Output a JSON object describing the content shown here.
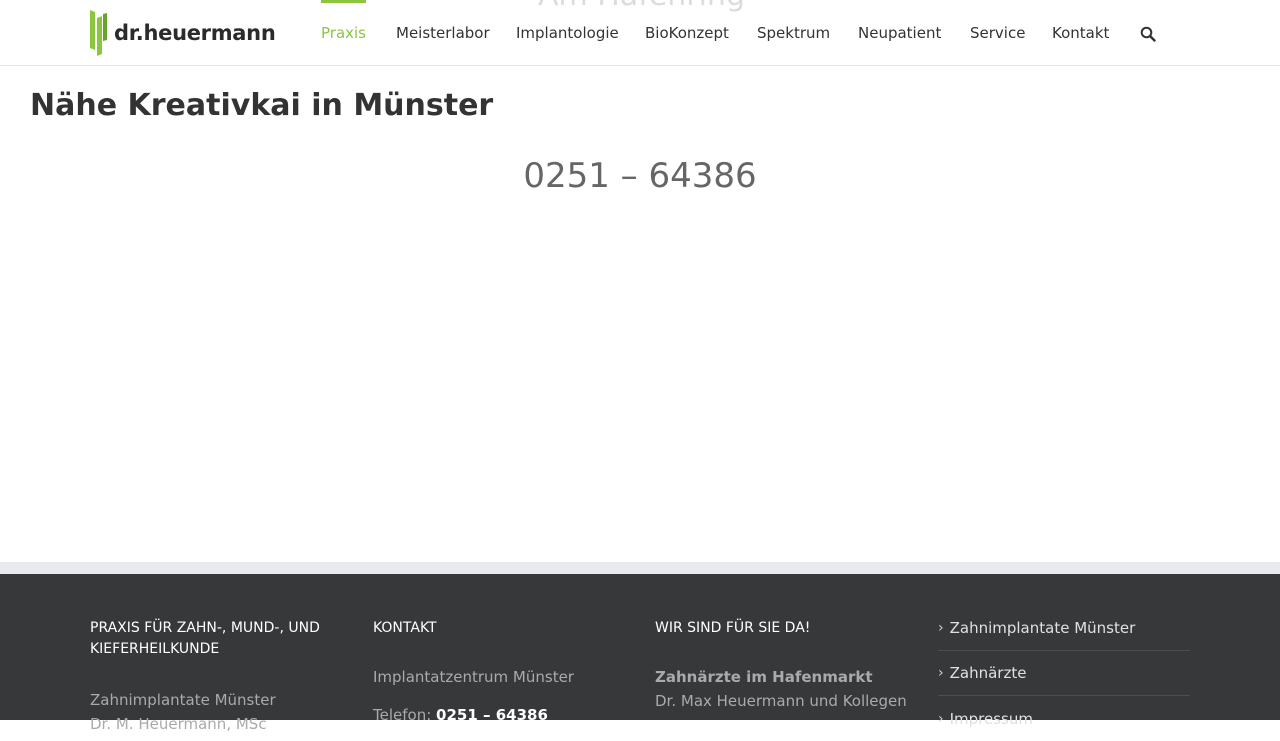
{
  "header": {
    "ghost_text": "Am Hafenring",
    "logo_text": "dr.heuermann",
    "logo_colors": {
      "green": "#8cc63f",
      "text": "#2b2b2b"
    },
    "nav": [
      {
        "label": "Praxis",
        "active": true
      },
      {
        "label": "Meisterlabor"
      },
      {
        "label": "Implantologie"
      },
      {
        "label": "BioKonzept"
      },
      {
        "label": "Spektrum"
      },
      {
        "label": "Neupatient"
      },
      {
        "label": "Service"
      },
      {
        "label": "Kontakt"
      }
    ],
    "search_icon": "search-icon"
  },
  "main": {
    "title": "Nähe Kreativkai in Münster",
    "phone": "0251 – 64386"
  },
  "footer": {
    "col1": {
      "heading": "PRAXIS FÜR ZAHN-, MUND-, UND KIEFERHEILKUNDE",
      "line1": "Zahnimplantate Münster",
      "line2": "Dr. M. Heuermann, MSc"
    },
    "col2": {
      "heading": "KONTAKT",
      "line1": "Implantatzentrum Münster",
      "phone_label": "Telefon:",
      "phone_value": "0251 – 64386"
    },
    "col3": {
      "heading": "WIR SIND FÜR SIE DA!",
      "line1": "Zahnärzte im Hafenmarkt",
      "line2": "Dr. Max Heuermann und Kollegen"
    },
    "links": [
      {
        "label": "Zahnimplantate Münster"
      },
      {
        "label": "Zahnärzte"
      },
      {
        "label": "Impressum"
      }
    ]
  },
  "colors": {
    "accent": "#8cc63f",
    "footer_bg": "#363839",
    "band": "#e8e9ec"
  }
}
